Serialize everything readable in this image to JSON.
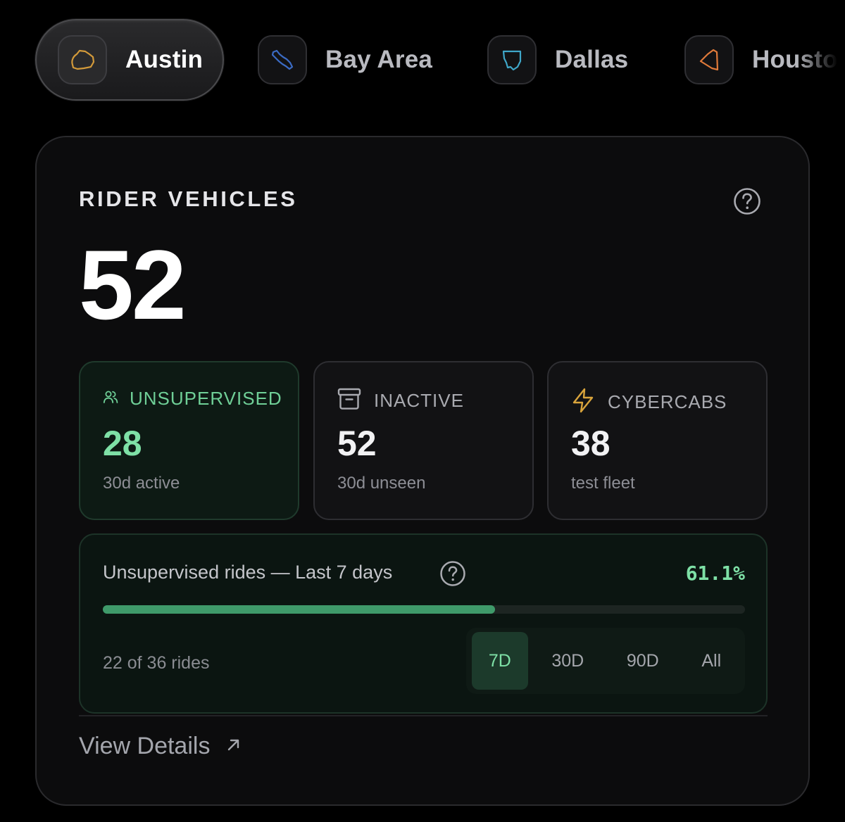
{
  "cities": [
    {
      "name": "Austin",
      "icon": "austin-map-icon",
      "color": "#d39a3a",
      "active": true
    },
    {
      "name": "Bay Area",
      "icon": "bay-area-map-icon",
      "color": "#3b6bc4",
      "active": false
    },
    {
      "name": "Dallas",
      "icon": "dallas-map-icon",
      "color": "#3fa7c9",
      "active": false
    },
    {
      "name": "Houston",
      "icon": "houston-map-icon",
      "color": "#e07a3a",
      "active": false
    }
  ],
  "card": {
    "title": "RIDER VEHICLES",
    "total": "52",
    "help_icon": "question-circle-icon"
  },
  "stats": [
    {
      "label": "UNSUPERVISED",
      "value": "28",
      "sub": "30d active",
      "icon": "users-icon",
      "color": "#6fcf97"
    },
    {
      "label": "INACTIVE",
      "value": "52",
      "sub": "30d unseen",
      "icon": "archive-box-icon",
      "color": "#a9aab0"
    },
    {
      "label": "CYBERCABS",
      "value": "38",
      "sub": "test fleet",
      "icon": "lightning-bolt-icon",
      "color": "#d9a43c"
    }
  ],
  "rides": {
    "title": "Unsupervised rides — Last 7 days",
    "percent": "61.1%",
    "progress": 0.611,
    "count": "22 of 36 rides",
    "ranges": [
      "7D",
      "30D",
      "90D",
      "All"
    ],
    "selected_range": "7D"
  },
  "footer": {
    "view_details": "View Details",
    "icon": "arrow-up-right-icon"
  }
}
